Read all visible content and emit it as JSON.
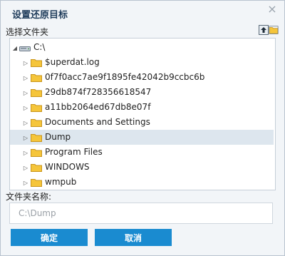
{
  "dialog": {
    "title": "设置还原目标",
    "close_glyph": "×"
  },
  "folder_section": {
    "label": "选择文件夹"
  },
  "tree": {
    "root": {
      "label": "C:\\",
      "icon": "drive-icon",
      "expanded": true
    },
    "items": [
      {
        "label": "$uperdat.log",
        "selected": false
      },
      {
        "label": "0f7f0acc7ae9f1895fe42042b9ccbc6b",
        "selected": false
      },
      {
        "label": "29db874f728356618547",
        "selected": false
      },
      {
        "label": "a11bb2064ed67db8e07f",
        "selected": false
      },
      {
        "label": "Documents and Settings",
        "selected": false
      },
      {
        "label": "Dump",
        "selected": true
      },
      {
        "label": "Program Files",
        "selected": false
      },
      {
        "label": "WINDOWS",
        "selected": false
      },
      {
        "label": "wmpub",
        "selected": false
      }
    ]
  },
  "folder_name": {
    "label": "文件夹名称:",
    "placeholder": "C:\\Dump"
  },
  "buttons": {
    "ok": "确定",
    "cancel": "取消"
  },
  "colors": {
    "accent": "#1a8bd0",
    "selected_row": "#dde6ee",
    "folder": "#f5c53a"
  }
}
